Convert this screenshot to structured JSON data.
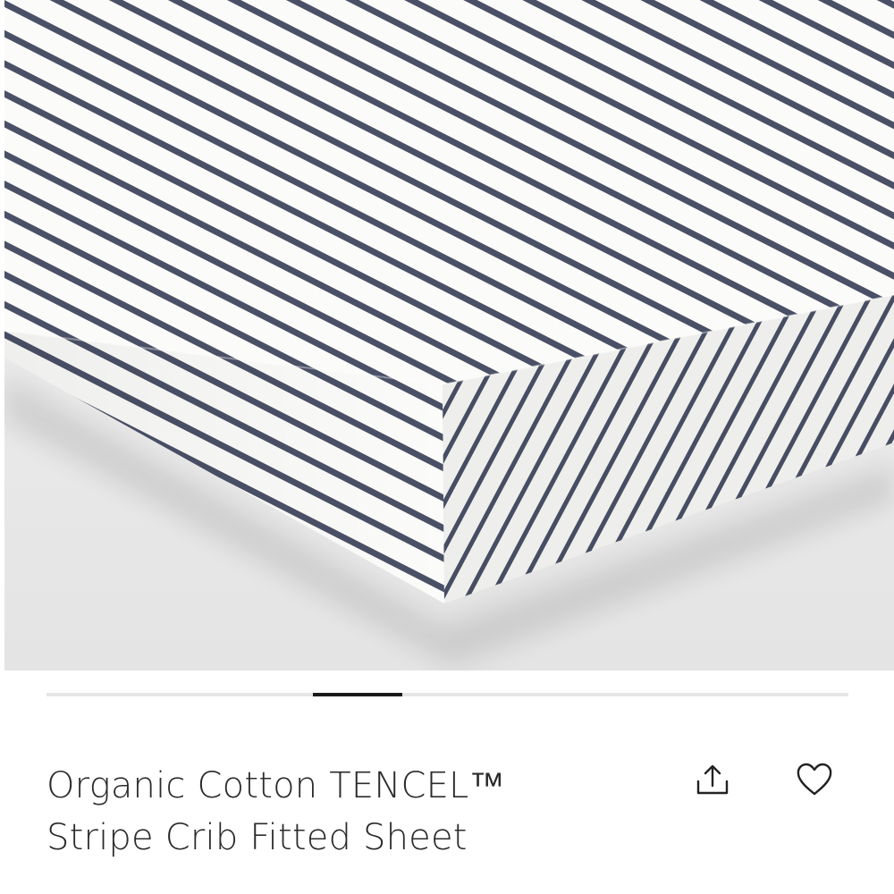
{
  "product": {
    "title_line1": "Organic Cotton TENCEL™",
    "title_line2": "Stripe Crib Fitted Sheet"
  },
  "gallery": {
    "image_subject": "crib fitted sheet with navy pinstripes",
    "stripe_color": "#4a5066",
    "fabric_color": "#fbfbf9",
    "background_color": "#e9e9e9"
  },
  "carousel": {
    "active_index": 1,
    "track_color": "#e6e6e6",
    "indicator_color": "#1a1a1a"
  },
  "actions": {
    "share_icon": "share-icon",
    "favorite_icon": "heart-icon"
  }
}
